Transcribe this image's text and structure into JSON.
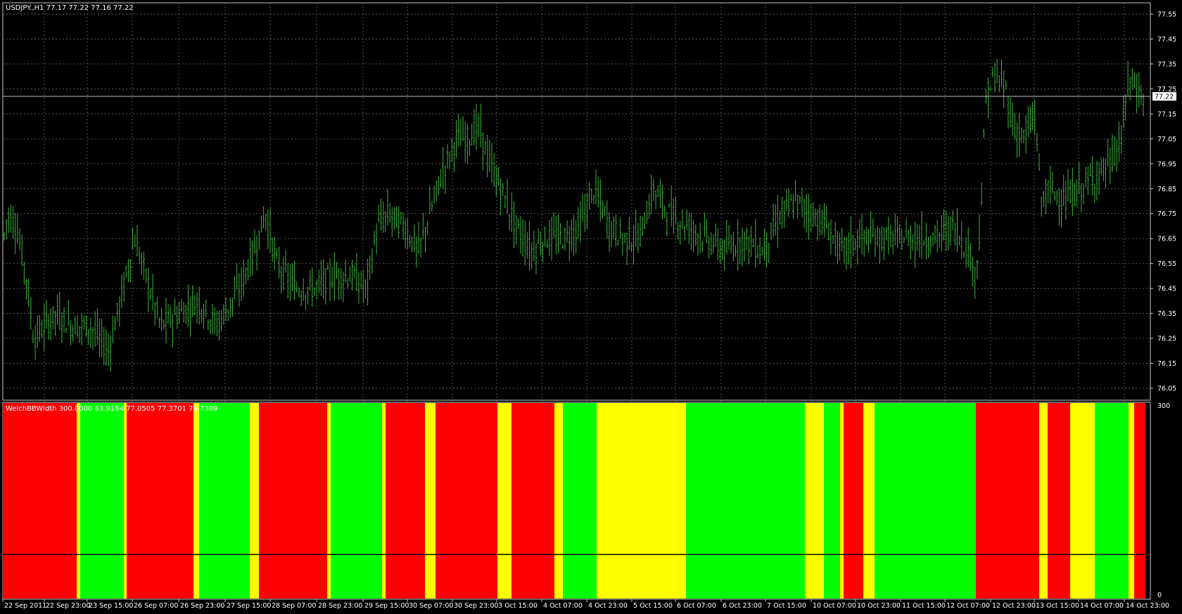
{
  "chart_data": {
    "type": "candlestick",
    "symbol_header": "USDJPY.,H1  77.17 77.22 77.16 77.22",
    "price_axis": {
      "ticks": [
        "77.55",
        "77.45",
        "77.35",
        "77.25",
        "77.15",
        "77.05",
        "76.95",
        "76.85",
        "76.75",
        "76.65",
        "76.55",
        "76.45",
        "76.35",
        "76.25",
        "76.15",
        "76.05"
      ],
      "ylim": [
        76.0,
        77.6
      ],
      "grid": true
    },
    "current_price_label": "77.22",
    "current_price": 77.22,
    "time_axis": {
      "labels": [
        "22 Sep 2011",
        "22 Sep 23:00",
        "23 Sep 15:00",
        "26 Sep 07:00",
        "26 Sep 23:00",
        "27 Sep 15:00",
        "28 Sep 07:00",
        "28 Sep 23:00",
        "29 Sep 15:00",
        "30 Sep 07:00",
        "30 Sep 23:00",
        "3 Oct 15:00",
        "4 Oct 07:00",
        "4 Oct 23:00",
        "5 Oct 15:00",
        "6 Oct 07:00",
        "6 Oct 23:00",
        "7 Oct 15:00",
        "10 Oct 07:00",
        "10 Oct 23:00",
        "11 Oct 15:00",
        "12 Oct 07:00",
        "12 Oct 23:00",
        "13 Oct 15:00",
        "14 Oct 07:00",
        "14 Oct 23:00"
      ]
    },
    "price_path": [
      {
        "x": 0,
        "price": 76.55
      },
      {
        "x": 10,
        "price": 76.75
      },
      {
        "x": 22,
        "price": 76.7
      },
      {
        "x": 35,
        "price": 76.5
      },
      {
        "x": 45,
        "price": 76.25
      },
      {
        "x": 60,
        "price": 76.3
      },
      {
        "x": 75,
        "price": 76.35
      },
      {
        "x": 95,
        "price": 76.3
      },
      {
        "x": 120,
        "price": 76.3
      },
      {
        "x": 145,
        "price": 76.2
      },
      {
        "x": 165,
        "price": 76.45
      },
      {
        "x": 180,
        "price": 76.65
      },
      {
        "x": 200,
        "price": 76.45
      },
      {
        "x": 215,
        "price": 76.3
      },
      {
        "x": 240,
        "price": 76.35
      },
      {
        "x": 265,
        "price": 76.4
      },
      {
        "x": 290,
        "price": 76.3
      },
      {
        "x": 320,
        "price": 76.45
      },
      {
        "x": 340,
        "price": 76.6
      },
      {
        "x": 355,
        "price": 76.75
      },
      {
        "x": 370,
        "price": 76.55
      },
      {
        "x": 395,
        "price": 76.45
      },
      {
        "x": 420,
        "price": 76.45
      },
      {
        "x": 445,
        "price": 76.5
      },
      {
        "x": 470,
        "price": 76.5
      },
      {
        "x": 490,
        "price": 76.45
      },
      {
        "x": 505,
        "price": 76.7
      },
      {
        "x": 520,
        "price": 76.75
      },
      {
        "x": 540,
        "price": 76.7
      },
      {
        "x": 560,
        "price": 76.6
      },
      {
        "x": 575,
        "price": 76.75
      },
      {
        "x": 590,
        "price": 76.9
      },
      {
        "x": 610,
        "price": 77.05
      },
      {
        "x": 625,
        "price": 77.05
      },
      {
        "x": 640,
        "price": 77.1
      },
      {
        "x": 655,
        "price": 76.95
      },
      {
        "x": 670,
        "price": 76.85
      },
      {
        "x": 690,
        "price": 76.7
      },
      {
        "x": 710,
        "price": 76.6
      },
      {
        "x": 730,
        "price": 76.65
      },
      {
        "x": 755,
        "price": 76.65
      },
      {
        "x": 775,
        "price": 76.7
      },
      {
        "x": 795,
        "price": 76.85
      },
      {
        "x": 815,
        "price": 76.7
      },
      {
        "x": 835,
        "price": 76.65
      },
      {
        "x": 855,
        "price": 76.65
      },
      {
        "x": 875,
        "price": 76.85
      },
      {
        "x": 895,
        "price": 76.75
      },
      {
        "x": 920,
        "price": 76.7
      },
      {
        "x": 945,
        "price": 76.65
      },
      {
        "x": 970,
        "price": 76.6
      },
      {
        "x": 995,
        "price": 76.65
      },
      {
        "x": 1020,
        "price": 76.6
      },
      {
        "x": 1045,
        "price": 76.75
      },
      {
        "x": 1065,
        "price": 76.8
      },
      {
        "x": 1085,
        "price": 76.75
      },
      {
        "x": 1105,
        "price": 76.7
      },
      {
        "x": 1125,
        "price": 76.6
      },
      {
        "x": 1150,
        "price": 76.65
      },
      {
        "x": 1175,
        "price": 76.65
      },
      {
        "x": 1200,
        "price": 76.65
      },
      {
        "x": 1225,
        "price": 76.65
      },
      {
        "x": 1250,
        "price": 76.65
      },
      {
        "x": 1275,
        "price": 76.7
      },
      {
        "x": 1295,
        "price": 76.6
      },
      {
        "x": 1305,
        "price": 76.5
      },
      {
        "x": 1312,
        "price": 76.75
      },
      {
        "x": 1318,
        "price": 77.2
      },
      {
        "x": 1330,
        "price": 77.3
      },
      {
        "x": 1345,
        "price": 77.25
      },
      {
        "x": 1355,
        "price": 77.1
      },
      {
        "x": 1370,
        "price": 77.05
      },
      {
        "x": 1385,
        "price": 77.15
      },
      {
        "x": 1392,
        "price": 76.8
      },
      {
        "x": 1405,
        "price": 76.85
      },
      {
        "x": 1425,
        "price": 76.8
      },
      {
        "x": 1445,
        "price": 76.85
      },
      {
        "x": 1465,
        "price": 76.9
      },
      {
        "x": 1485,
        "price": 76.95
      },
      {
        "x": 1500,
        "price": 77.05
      },
      {
        "x": 1510,
        "price": 77.3
      },
      {
        "x": 1520,
        "price": 77.25
      },
      {
        "x": 1532,
        "price": 77.2
      }
    ],
    "indicator": {
      "label": "WelchBBWidth 300.0000 63.9184 77.0505 77.3701 76.7309",
      "axis_ticks": [
        "300",
        "0"
      ],
      "ylim": [
        0,
        300
      ],
      "line_value": 63.9,
      "colors": {
        "red": "#ff0000",
        "yellow": "#ffff00",
        "green": "#00ff00"
      },
      "segments": [
        {
          "from": 4,
          "to": 109,
          "color": "red"
        },
        {
          "from": 109,
          "to": 114,
          "color": "yellow"
        },
        {
          "from": 114,
          "to": 176,
          "color": "green"
        },
        {
          "from": 176,
          "to": 180,
          "color": "yellow"
        },
        {
          "from": 180,
          "to": 275,
          "color": "red"
        },
        {
          "from": 275,
          "to": 283,
          "color": "yellow"
        },
        {
          "from": 283,
          "to": 355,
          "color": "green"
        },
        {
          "from": 355,
          "to": 368,
          "color": "yellow"
        },
        {
          "from": 368,
          "to": 465,
          "color": "red"
        },
        {
          "from": 465,
          "to": 470,
          "color": "yellow"
        },
        {
          "from": 470,
          "to": 543,
          "color": "green"
        },
        {
          "from": 543,
          "to": 548,
          "color": "yellow"
        },
        {
          "from": 548,
          "to": 604,
          "color": "red"
        },
        {
          "from": 604,
          "to": 619,
          "color": "yellow"
        },
        {
          "from": 619,
          "to": 707,
          "color": "red"
        },
        {
          "from": 707,
          "to": 727,
          "color": "yellow"
        },
        {
          "from": 727,
          "to": 788,
          "color": "red"
        },
        {
          "from": 788,
          "to": 800,
          "color": "yellow"
        },
        {
          "from": 800,
          "to": 848,
          "color": "green"
        },
        {
          "from": 848,
          "to": 975,
          "color": "yellow"
        },
        {
          "from": 975,
          "to": 1144,
          "color": "green"
        },
        {
          "from": 1144,
          "to": 1171,
          "color": "yellow"
        },
        {
          "from": 1171,
          "to": 1194,
          "color": "green"
        },
        {
          "from": 1194,
          "to": 1199,
          "color": "yellow"
        },
        {
          "from": 1199,
          "to": 1227,
          "color": "red"
        },
        {
          "from": 1227,
          "to": 1243,
          "color": "yellow"
        },
        {
          "from": 1243,
          "to": 1387,
          "color": "green"
        },
        {
          "from": 1387,
          "to": 1477,
          "color": "red"
        },
        {
          "from": 1477,
          "to": 1489,
          "color": "yellow"
        },
        {
          "from": 1489,
          "to": 1521,
          "color": "red"
        },
        {
          "from": 1521,
          "to": 1556,
          "color": "yellow"
        },
        {
          "from": 1556,
          "to": 1604,
          "color": "green"
        },
        {
          "from": 1604,
          "to": 1612,
          "color": "yellow"
        },
        {
          "from": 1612,
          "to": 1628,
          "color": "red"
        },
        {
          "from": 1628,
          "to": 1633,
          "color": "black"
        }
      ]
    }
  }
}
